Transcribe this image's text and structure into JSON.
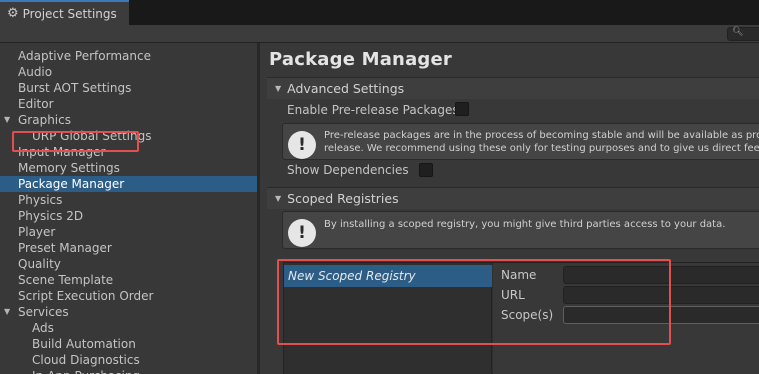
{
  "window": {
    "tab_title": "Project Settings",
    "tab_icon": "gear-icon",
    "search_placeholder": ""
  },
  "sidebar": {
    "items": [
      {
        "label": "Adaptive Performance",
        "indent": 0
      },
      {
        "label": "Audio",
        "indent": 0
      },
      {
        "label": "Burst AOT Settings",
        "indent": 0
      },
      {
        "label": "Editor",
        "indent": 0
      },
      {
        "label": "Graphics",
        "indent": 0,
        "expanded": true
      },
      {
        "label": "URP Global Settings",
        "indent": 1
      },
      {
        "label": "Input Manager",
        "indent": 0
      },
      {
        "label": "Memory Settings",
        "indent": 0
      },
      {
        "label": "Package Manager",
        "indent": 0,
        "selected": true
      },
      {
        "label": "Physics",
        "indent": 0
      },
      {
        "label": "Physics 2D",
        "indent": 0
      },
      {
        "label": "Player",
        "indent": 0
      },
      {
        "label": "Preset Manager",
        "indent": 0
      },
      {
        "label": "Quality",
        "indent": 0
      },
      {
        "label": "Scene Template",
        "indent": 0
      },
      {
        "label": "Script Execution Order",
        "indent": 0
      },
      {
        "label": "Services",
        "indent": 0,
        "expanded": true
      },
      {
        "label": "Ads",
        "indent": 1
      },
      {
        "label": "Build Automation",
        "indent": 1
      },
      {
        "label": "Cloud Diagnostics",
        "indent": 1
      },
      {
        "label": "In-App Purchasing",
        "indent": 1
      }
    ]
  },
  "main": {
    "title": "Package Manager",
    "advanced": {
      "header": "Advanced Settings",
      "prerelease_label": "Enable Pre-release Packages",
      "prerelease_checked": false,
      "help_line1": "Pre-release packages are in the process of becoming stable and will be available as production-ready",
      "help_line2": "release. We recommend using these only for testing purposes and to give us direct feedback.",
      "show_dependencies_label": "Show Dependencies",
      "show_dependencies_checked": false
    },
    "scoped": {
      "header": "Scoped Registries",
      "help_text": "By installing a scoped registry, you might give third parties access to your data.",
      "registry_item": "New Scoped Registry",
      "name_label": "Name",
      "url_label": "URL",
      "scopes_label": "Scope(s)",
      "name_value": "",
      "url_value": "",
      "scopes_value": ""
    }
  },
  "colors": {
    "selection": "#2c5d87",
    "highlight": "#e34e4e",
    "tab_accent": "#3a79bb"
  }
}
